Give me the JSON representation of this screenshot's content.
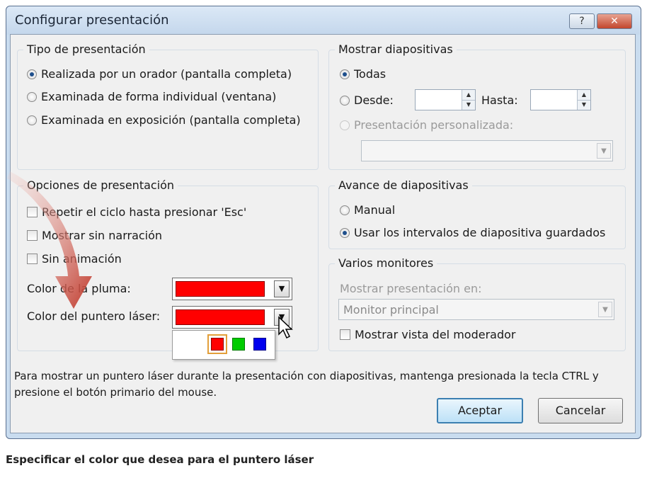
{
  "dialog": {
    "title": "Configurar presentación",
    "help_label": "?",
    "close_label": "✕"
  },
  "tipo": {
    "title": "Tipo de presentación",
    "options": [
      {
        "label": "Realizada por un orador (pantalla completa)",
        "selected": true
      },
      {
        "label": "Examinada de forma individual (ventana)",
        "selected": false
      },
      {
        "label": "Examinada en exposición (pantalla completa)",
        "selected": false
      }
    ]
  },
  "mostrar": {
    "title": "Mostrar diapositivas",
    "todas": "Todas",
    "desde": "Desde:",
    "hasta": "Hasta:",
    "personalizada": "Presentación personalizada:"
  },
  "opciones": {
    "title": "Opciones de presentación",
    "repetir": "Repetir el ciclo hasta presionar 'Esc'",
    "sin_narracion": "Mostrar sin narración",
    "sin_animacion": "Sin animación",
    "color_pluma": "Color de la pluma:",
    "color_laser": "Color del puntero láser:",
    "pen_color": "#ff0000",
    "laser_color": "#ff0000",
    "laser_palette": [
      "#ff0000",
      "#00cc00",
      "#0000ee"
    ]
  },
  "avance": {
    "title": "Avance de diapositivas",
    "manual": "Manual",
    "intervalos": "Usar los intervalos de diapositiva guardados"
  },
  "monitores": {
    "title": "Varios monitores",
    "mostrar_en": "Mostrar presentación en:",
    "monitor_value": "Monitor principal",
    "vista_moderador": "Mostrar vista del moderador"
  },
  "info_text": "Para mostrar un puntero láser durante la presentación con diapositivas, mantenga presionada la tecla CTRL y presione el botón primario del mouse.",
  "buttons": {
    "accept": "Aceptar",
    "cancel": "Cancelar"
  },
  "caption": "Especificar el color que desea para el puntero láser",
  "colors": {
    "accent": "#3c7fb1",
    "arrow": "#c0392b"
  }
}
